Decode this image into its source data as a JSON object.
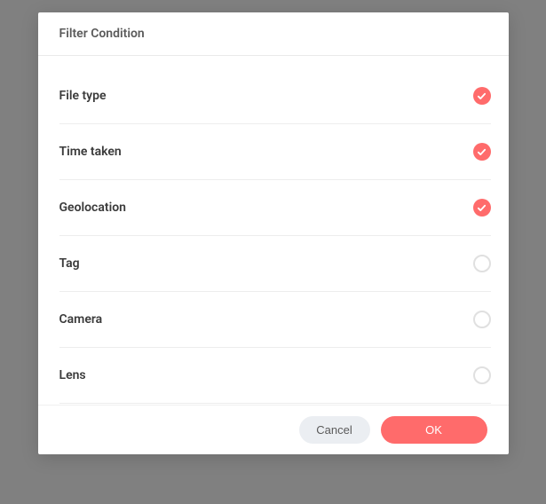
{
  "modal": {
    "title": "Filter Condition",
    "items": [
      {
        "label": "File type",
        "checked": true
      },
      {
        "label": "Time taken",
        "checked": true
      },
      {
        "label": "Geolocation",
        "checked": true
      },
      {
        "label": "Tag",
        "checked": false
      },
      {
        "label": "Camera",
        "checked": false
      },
      {
        "label": "Lens",
        "checked": false
      }
    ],
    "footer": {
      "cancel": "Cancel",
      "ok": "OK"
    }
  }
}
